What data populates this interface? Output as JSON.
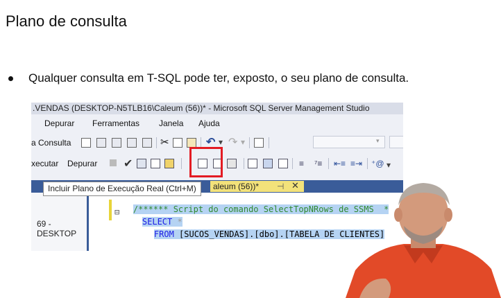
{
  "slide": {
    "title": "Plano de consulta",
    "bullet": "Qualquer consulta em T-SQL pode ter, exposto, o seu plano de consulta."
  },
  "ssms": {
    "window_title": ".VENDAS (DESKTOP-N5TLB16\\Caleum (56))* - Microsoft SQL Server Management Studio",
    "menu": [
      "Depurar",
      "Ferramentas",
      "Janela",
      "Ajuda"
    ],
    "toolbar1_label": "a Consulta",
    "toolbar2_labels": [
      "xecutar",
      "Depurar"
    ],
    "tab_label": "aleum (56))*",
    "tab_pin": "⊣",
    "tab_close": "✕",
    "server_label": "69 - DESKTOP",
    "code": {
      "comment": "/****** Script do comando SelectTopNRows de SSMS  *",
      "line2_kw": "SELECT",
      "line2_rest": " *",
      "line3_kw": "FROM",
      "line3_rest": " [SUCOS_VENDAS].[dbo].[TABELA DE CLIENTES]"
    },
    "tooltip": "Incluir Plano de Execução Real (Ctrl+M)"
  },
  "colors": {
    "highlight_border": "#e31b23",
    "tab_background": "#f3e27a",
    "keyword": "#1a1ae6",
    "comment": "#2f8a2f",
    "selection": "#b5d3f3"
  }
}
